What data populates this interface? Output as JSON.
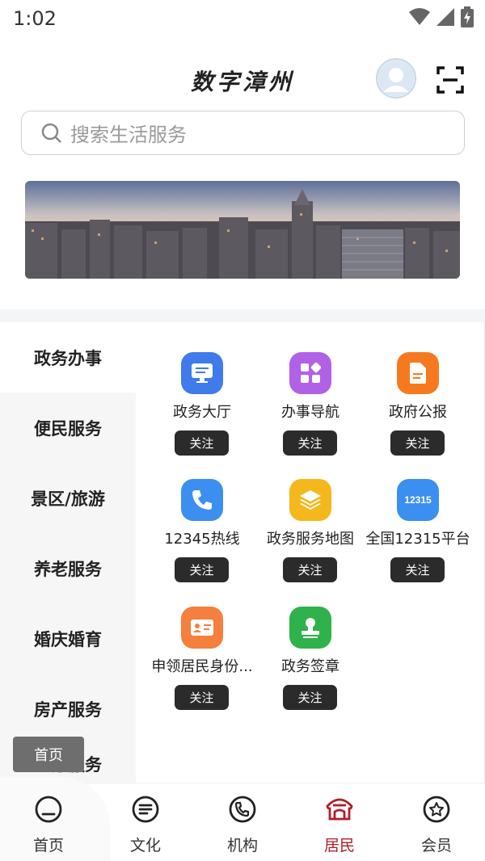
{
  "status_bar": {
    "time": "1:02",
    "icons": [
      "wifi-icon",
      "signal-icon",
      "battery-charging-icon"
    ]
  },
  "header": {
    "title": "数字漳州",
    "avatar": "avatar-icon",
    "scan": "scan-icon"
  },
  "search": {
    "placeholder": "搜索生活服务"
  },
  "sidebar": {
    "items": [
      {
        "label": "政务办事",
        "active": true
      },
      {
        "label": "便民服务"
      },
      {
        "label": "景区/旅游"
      },
      {
        "label": "养老服务"
      },
      {
        "label": "婚庆婚育"
      },
      {
        "label": "房产服务"
      },
      {
        "label": "医疗服务"
      }
    ]
  },
  "services": [
    {
      "label": "政务大厅",
      "follow": "关注",
      "icon": "monitor-icon",
      "color": "#3f7bea"
    },
    {
      "label": "办事导航",
      "follow": "关注",
      "icon": "apps-icon",
      "color": "#b061e6"
    },
    {
      "label": "政府公报",
      "follow": "关注",
      "icon": "document-icon",
      "color": "#f57a1f"
    },
    {
      "label": "12345热线",
      "follow": "关注",
      "icon": "phone-icon",
      "color": "#3b8ff0"
    },
    {
      "label": "政务服务地图",
      "follow": "关注",
      "icon": "layers-icon",
      "color": "#f4b81c"
    },
    {
      "label": "全国12315平台",
      "follow": "关注",
      "icon": "12315-icon",
      "icon_text": "12315",
      "color": "#3b8ff0"
    },
    {
      "label": "申领居民身份...",
      "follow": "关注",
      "icon": "id-card-icon",
      "color": "#f57f3c"
    },
    {
      "label": "政务签章",
      "follow": "关注",
      "icon": "stamp-icon",
      "color": "#2fb14b"
    }
  ],
  "toast": {
    "text": "首页"
  },
  "bottom_nav": {
    "items": [
      {
        "label": "首页",
        "icon": "home-icon"
      },
      {
        "label": "文化",
        "icon": "culture-icon"
      },
      {
        "label": "机构",
        "icon": "phone-circle-icon"
      },
      {
        "label": "居民",
        "icon": "resident-icon",
        "active": true
      },
      {
        "label": "会员",
        "icon": "member-star-icon"
      }
    ]
  },
  "colors": {
    "accent": "#b01e2a",
    "follow_button": "#2b2b2b"
  }
}
